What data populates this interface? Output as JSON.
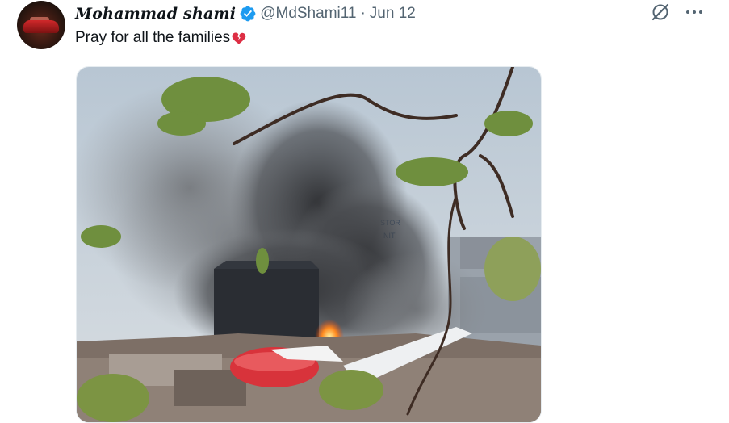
{
  "tweet": {
    "display_name": "Mohammad shami",
    "handle": "@MdShami11",
    "separator": "·",
    "date": "Jun 12",
    "text": "Pray for all the families",
    "emoji_icon": "broken-heart-icon",
    "verified_icon": "verified-badge-icon",
    "actions": [
      "grok-icon",
      "more-options-icon"
    ]
  },
  "colors": {
    "verified": "#1d9bf0",
    "secondary_text": "#536471",
    "primary_text": "#0f1419",
    "heart": "#e0245e"
  },
  "media": {
    "alt_subject": "photo-smoke-fire-wreckage",
    "store_sign": "STOR\nNIT"
  }
}
